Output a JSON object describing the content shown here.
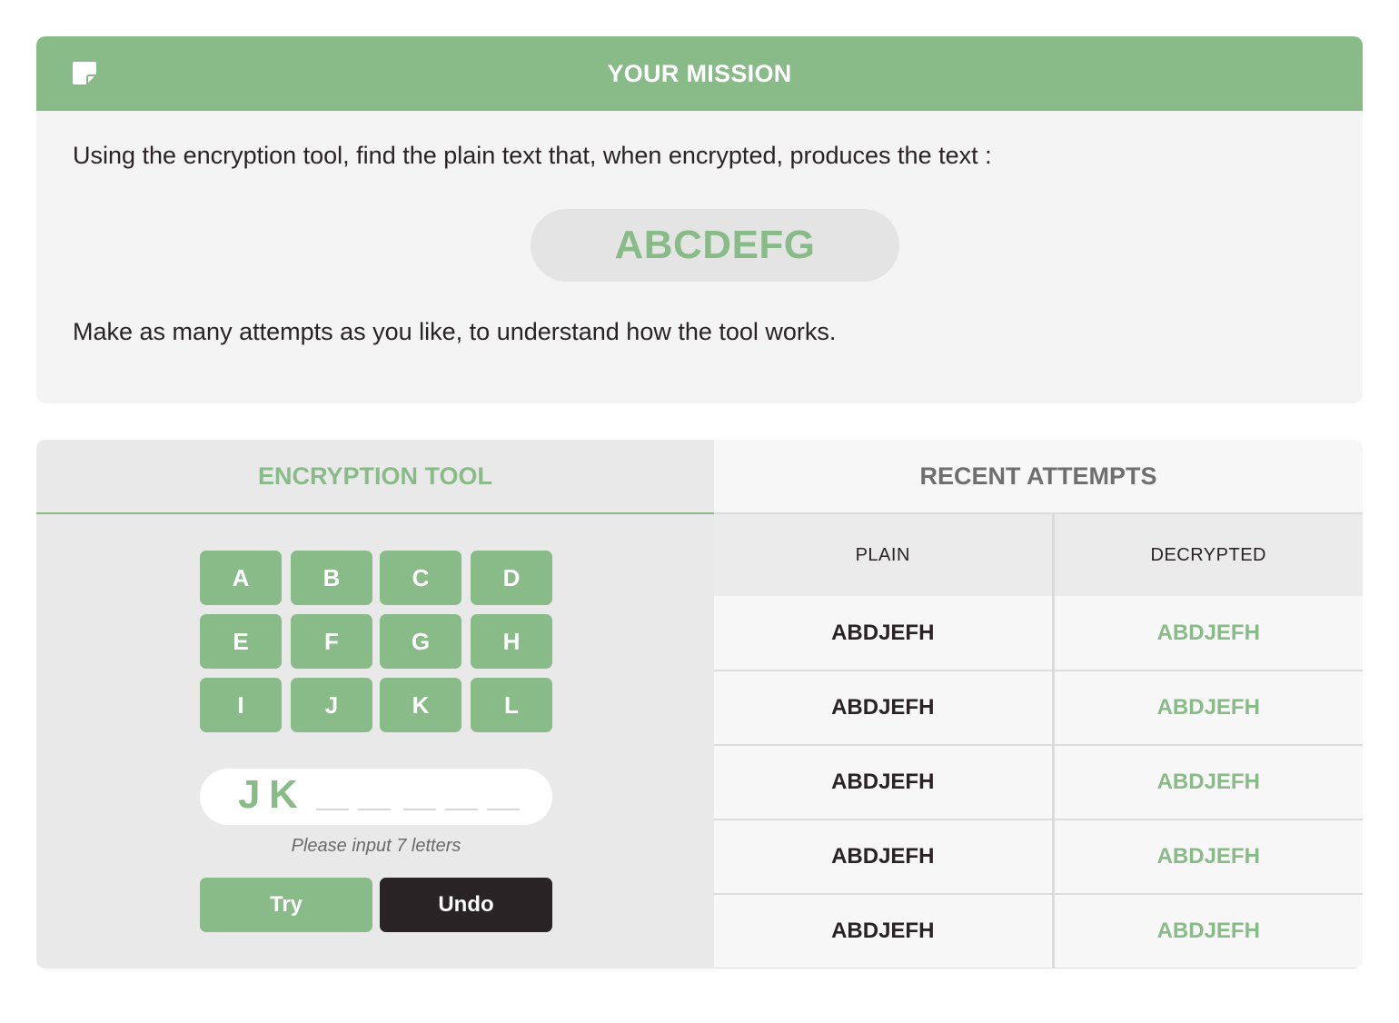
{
  "mission": {
    "title": "YOUR MISSION",
    "instruction": "Using the encryption tool, find the plain text that, when encrypted, produces the text :",
    "target_text": "ABCDEFG",
    "footer": "Make as many attempts as you like, to understand how the tool works."
  },
  "tool": {
    "tab_label": "ENCRYPTION TOOL",
    "keys": [
      "A",
      "B",
      "C",
      "D",
      "E",
      "F",
      "G",
      "H",
      "I",
      "J",
      "K",
      "L"
    ],
    "typed_letters": [
      "J",
      "K"
    ],
    "empty_slots": 5,
    "hint": "Please input 7 letters",
    "try_label": "Try",
    "undo_label": "Undo"
  },
  "attempts": {
    "tab_label": "RECENT ATTEMPTS",
    "columns": [
      "PLAIN",
      "DECRYPTED"
    ],
    "rows": [
      {
        "plain": "ABDJEFH",
        "decrypted": "ABDJEFH"
      },
      {
        "plain": "ABDJEFH",
        "decrypted": "ABDJEFH"
      },
      {
        "plain": "ABDJEFH",
        "decrypted": "ABDJEFH"
      },
      {
        "plain": "ABDJEFH",
        "decrypted": "ABDJEFH"
      },
      {
        "plain": "ABDJEFH",
        "decrypted": "ABDJEFH"
      }
    ]
  },
  "colors": {
    "accent": "#89bb88",
    "dark": "#2a2326",
    "panel": "#f4f4f4"
  },
  "icons": {
    "header_icon": "sticky-note-icon"
  }
}
